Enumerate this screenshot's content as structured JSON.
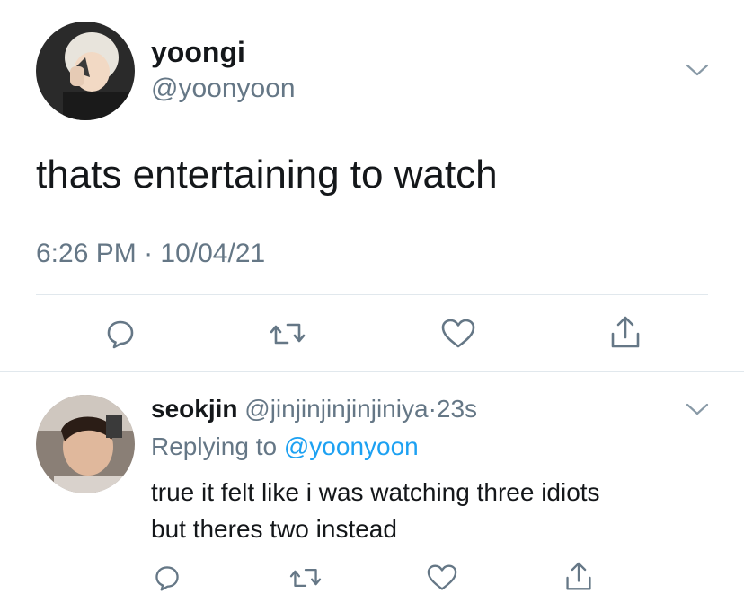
{
  "main_tweet": {
    "display_name": "yoongi",
    "handle": "@yoonyoon",
    "text": "thats entertaining to watch",
    "time": "6:26 PM",
    "separator": "·",
    "date": "10/04/21",
    "avatar_icon": "profile-photo",
    "menu_icon": "chevron-down-icon",
    "actions": [
      {
        "name": "reply",
        "icon": "reply-icon"
      },
      {
        "name": "retweet",
        "icon": "retweet-icon"
      },
      {
        "name": "like",
        "icon": "heart-icon"
      },
      {
        "name": "share",
        "icon": "share-icon"
      }
    ]
  },
  "reply_tweet": {
    "display_name": "seokjin",
    "handle": "@jinjinjinjinjiniya",
    "separator": "·",
    "time_ago": "23s",
    "replying_prefix": "Replying to",
    "replying_to": "@yoonyoon",
    "text_line1": "true it felt like i was watching three idiots",
    "text_line2": "but theres two instead",
    "avatar_icon": "profile-photo",
    "menu_icon": "chevron-down-icon"
  },
  "colors": {
    "text_primary": "#14171a",
    "text_secondary": "#657786",
    "accent": "#1da1f2",
    "divider": "#e1e8ed"
  }
}
